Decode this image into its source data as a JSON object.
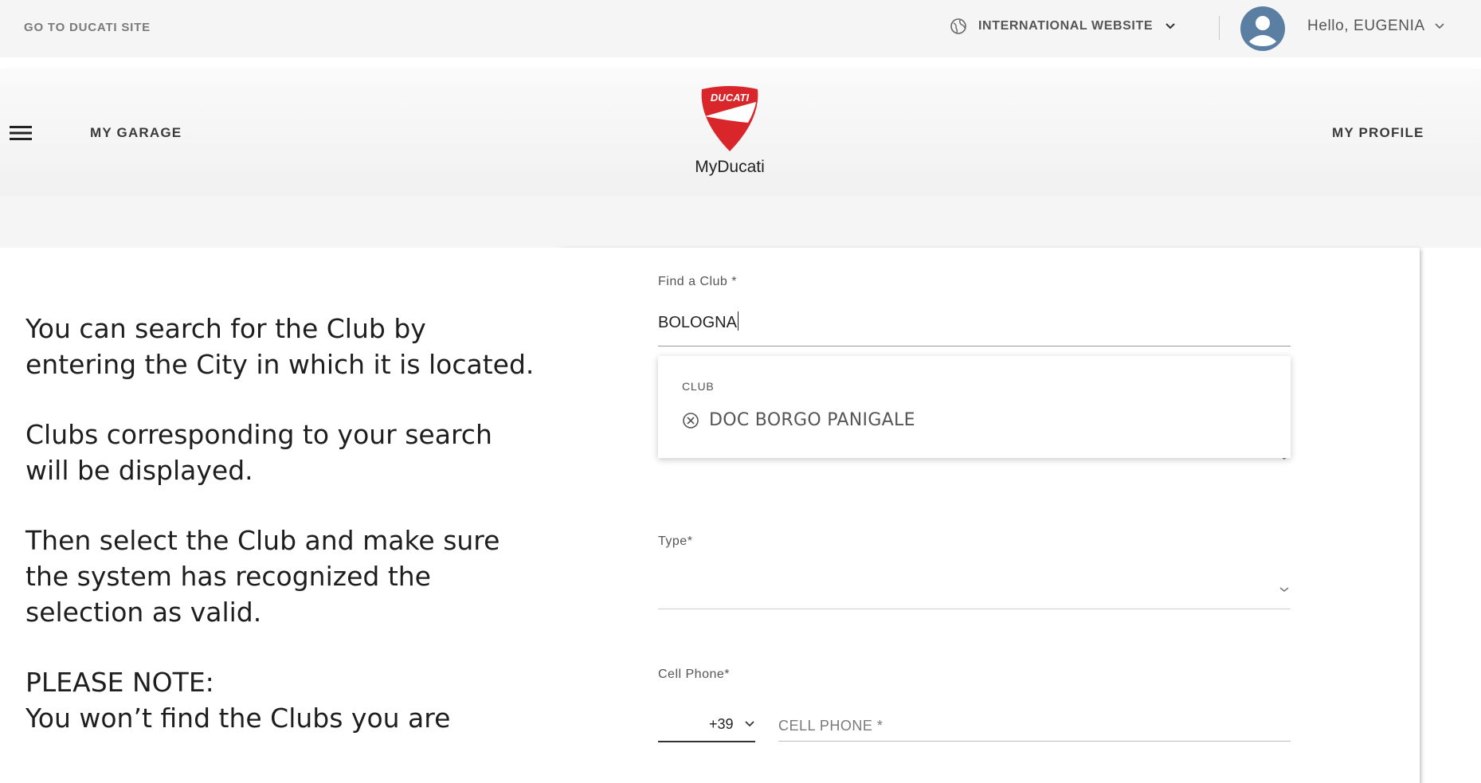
{
  "topbar": {
    "go_site": "GO TO DUCATI SITE",
    "international": "INTERNATIONAL WEBSITE",
    "greeting": "Hello, EUGENIA"
  },
  "header": {
    "menu_left": "MY GARAGE",
    "brand_badge": "DUCATI",
    "brand_name": "MyDucati",
    "menu_right": "MY PROFILE"
  },
  "help": {
    "p1": "You can search for the Club by entering the City in which it is located.",
    "p2": "Clubs corresponding to your search will be displayed.",
    "p3": "Then select the Club and make sure the system has recognized the selection as valid.",
    "note_title": "PLEASE NOTE:",
    "note_text": "You won’t find the Clubs you are"
  },
  "form": {
    "club_label": "Find a Club *",
    "club_value": "BOLOGNA",
    "dropdown_header": "CLUB",
    "dropdown_option": "DOC BORGO PANIGALE",
    "type_label": "Type*",
    "phone_label": "Cell Phone*",
    "phone_prefix": "+39",
    "phone_placeholder": "CELL PHONE *"
  },
  "colors": {
    "brand_red": "#d9262b",
    "avatar": "#5b7fa3",
    "topbar_bg": "#f5f5f5"
  },
  "icons": {
    "globe": "globe-icon",
    "chevron": "chevron-down-icon",
    "avatar": "user-avatar-icon",
    "menu": "hamburger-menu-icon",
    "clear": "clear-circle-icon"
  }
}
